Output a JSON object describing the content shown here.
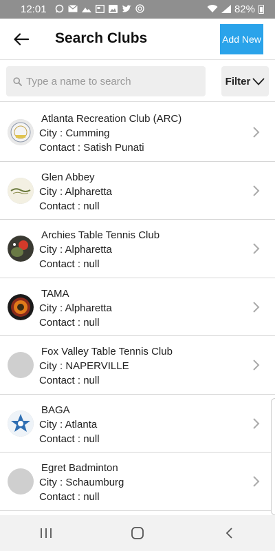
{
  "status_bar": {
    "time": "12:01",
    "battery": "82%",
    "left_icons": [
      "whatsapp-icon",
      "email-icon",
      "gallery-icon",
      "news-icon",
      "image-icon",
      "twitter-icon",
      "instagram-icon"
    ],
    "right_icons": [
      "wifi-icon",
      "signal-icon",
      "battery-icon"
    ]
  },
  "header": {
    "title": "Search Clubs",
    "add_new_label": "Add New",
    "accent": "#2aa3ea"
  },
  "search": {
    "placeholder": "Type a name to search",
    "value": "",
    "filter_label": "Filter"
  },
  "clubs": [
    {
      "name": "Atlanta Recreation Club (ARC)",
      "city": "City : Cumming",
      "contact": "Contact : Satish Punati",
      "avatar": "logo-arc"
    },
    {
      "name": "Glen Abbey",
      "city": "City : Alpharetta",
      "contact": "Contact : null",
      "avatar": "logo-glen-abbey"
    },
    {
      "name": "Archies Table Tennis Club",
      "city": "City : Alpharetta",
      "contact": "Contact : null",
      "avatar": "logo-archies"
    },
    {
      "name": "TAMA",
      "city": "City : Alpharetta",
      "contact": "Contact : null",
      "avatar": "logo-tama"
    },
    {
      "name": "Fox Valley Table Tennis Club",
      "city": "City : NAPERVILLE",
      "contact": "Contact : null",
      "avatar": "placeholder"
    },
    {
      "name": "BAGA",
      "city": "City : Atlanta",
      "contact": "Contact : null",
      "avatar": "logo-baga"
    },
    {
      "name": "Egret Badminton",
      "city": "City : Schaumburg",
      "contact": "Contact : null",
      "avatar": "placeholder"
    }
  ],
  "nav": {
    "items": [
      "recent-apps-icon",
      "home-icon",
      "back-icon"
    ]
  }
}
